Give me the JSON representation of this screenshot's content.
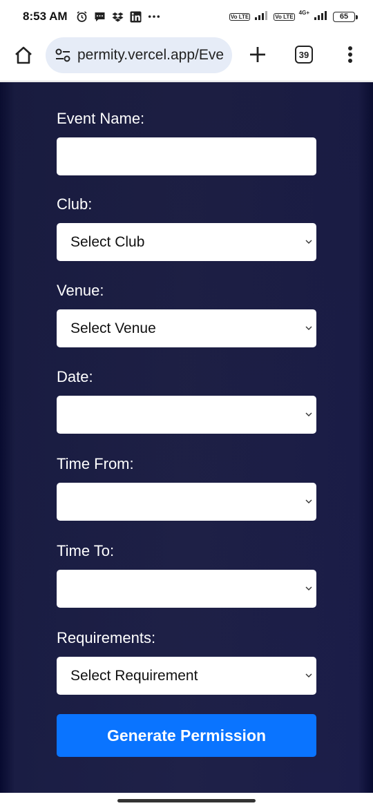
{
  "status_bar": {
    "time": "8:53 AM",
    "icons": [
      "alarm-icon",
      "message-icon",
      "dropbox-icon",
      "linkedin-icon",
      "more-icon"
    ],
    "net1": "Vo LTE",
    "net2": "Vo LTE",
    "network_type": "4G+",
    "battery": "65"
  },
  "browser": {
    "url": "permity.vercel.app/Eve",
    "tab_count": "39"
  },
  "form": {
    "event_name_label": "Event Name:",
    "event_name_value": "",
    "club_label": "Club:",
    "club_value": "Select Club",
    "venue_label": "Venue:",
    "venue_value": "Select Venue",
    "date_label": "Date:",
    "date_value": "",
    "time_from_label": "Time From:",
    "time_from_value": "",
    "time_to_label": "Time To:",
    "time_to_value": "",
    "requirements_label": "Requirements:",
    "requirements_value": "Select Requirement",
    "submit_label": "Generate Permission"
  },
  "colors": {
    "accent": "#0a74ff",
    "background": "#1f2148",
    "url_pill": "#e6ecf7"
  }
}
